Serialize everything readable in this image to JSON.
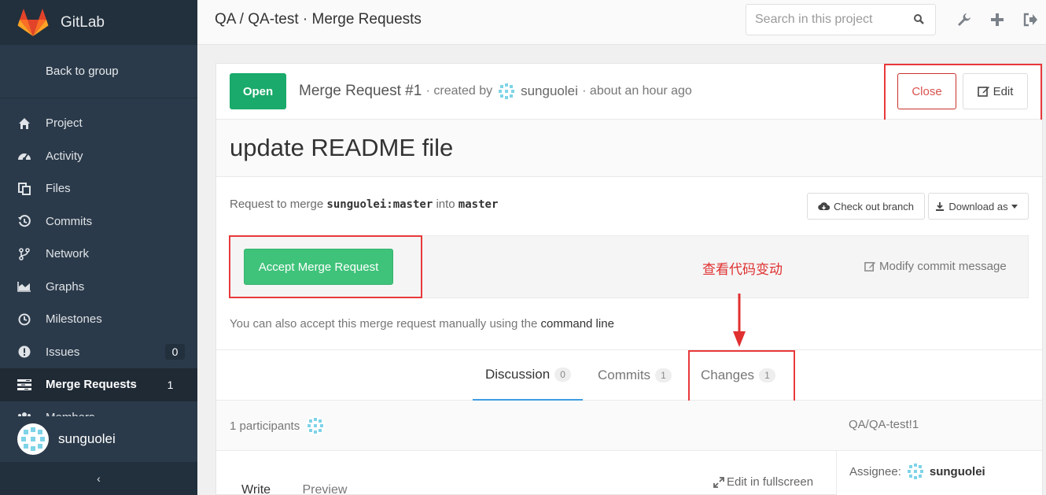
{
  "app": {
    "brand": "GitLab"
  },
  "sidebar": {
    "back_label": "Back to group",
    "items": [
      {
        "label": "Project",
        "icon": "home-icon",
        "count": ""
      },
      {
        "label": "Activity",
        "icon": "dashboard-icon",
        "count": ""
      },
      {
        "label": "Files",
        "icon": "files-icon",
        "count": ""
      },
      {
        "label": "Commits",
        "icon": "history-icon",
        "count": ""
      },
      {
        "label": "Network",
        "icon": "code-fork-icon",
        "count": ""
      },
      {
        "label": "Graphs",
        "icon": "area-chart-icon",
        "count": ""
      },
      {
        "label": "Milestones",
        "icon": "clock-icon",
        "count": ""
      },
      {
        "label": "Issues",
        "icon": "exclamation-circle-icon",
        "count": "0"
      },
      {
        "label": "Merge Requests",
        "icon": "tasks-icon",
        "count": "1",
        "active": true
      },
      {
        "label": "Members",
        "icon": "users-icon",
        "count": ""
      }
    ],
    "user": "sunguolei",
    "collapse_glyph": "‹"
  },
  "topbar": {
    "title": "QA / QA-test · Merge Requests",
    "search_placeholder": "Search in this project"
  },
  "mr": {
    "state": "Open",
    "heading": "Merge Request #1",
    "created_by": "· created by",
    "author": "sunguolei",
    "time": "· about an hour ago",
    "close_label": "Close",
    "edit_label": "Edit",
    "title": "update README file",
    "request_prefix": "Request to merge",
    "source_branch": "sunguolei:master",
    "into": "into",
    "target_branch": "master",
    "checkout_label": "Check out branch",
    "download_label": "Download as",
    "accept_label": "Accept Merge Request",
    "modify_label": "Modify commit message",
    "hint_prefix": "You can also accept this merge request manually using the",
    "hint_link": "command line",
    "annotation": "查看代码变动"
  },
  "tabs": [
    {
      "label": "Discussion",
      "count": "0"
    },
    {
      "label": "Commits",
      "count": "1"
    },
    {
      "label": "Changes",
      "count": "1"
    }
  ],
  "participants": {
    "label": "1 participants",
    "project_ref": "QA/QA-test!1"
  },
  "assignee": {
    "label": "Assignee:",
    "name": "sunguolei"
  },
  "editor": {
    "write": "Write",
    "preview": "Preview",
    "fullscreen": "Edit in fullscreen"
  },
  "colors": {
    "sidebar": "#2b3a4a",
    "open": "#1aaa6b",
    "accept": "#3fc37a",
    "close": "#d9534f",
    "highlight": "#e8393b",
    "tab_active": "#3d9de3"
  }
}
